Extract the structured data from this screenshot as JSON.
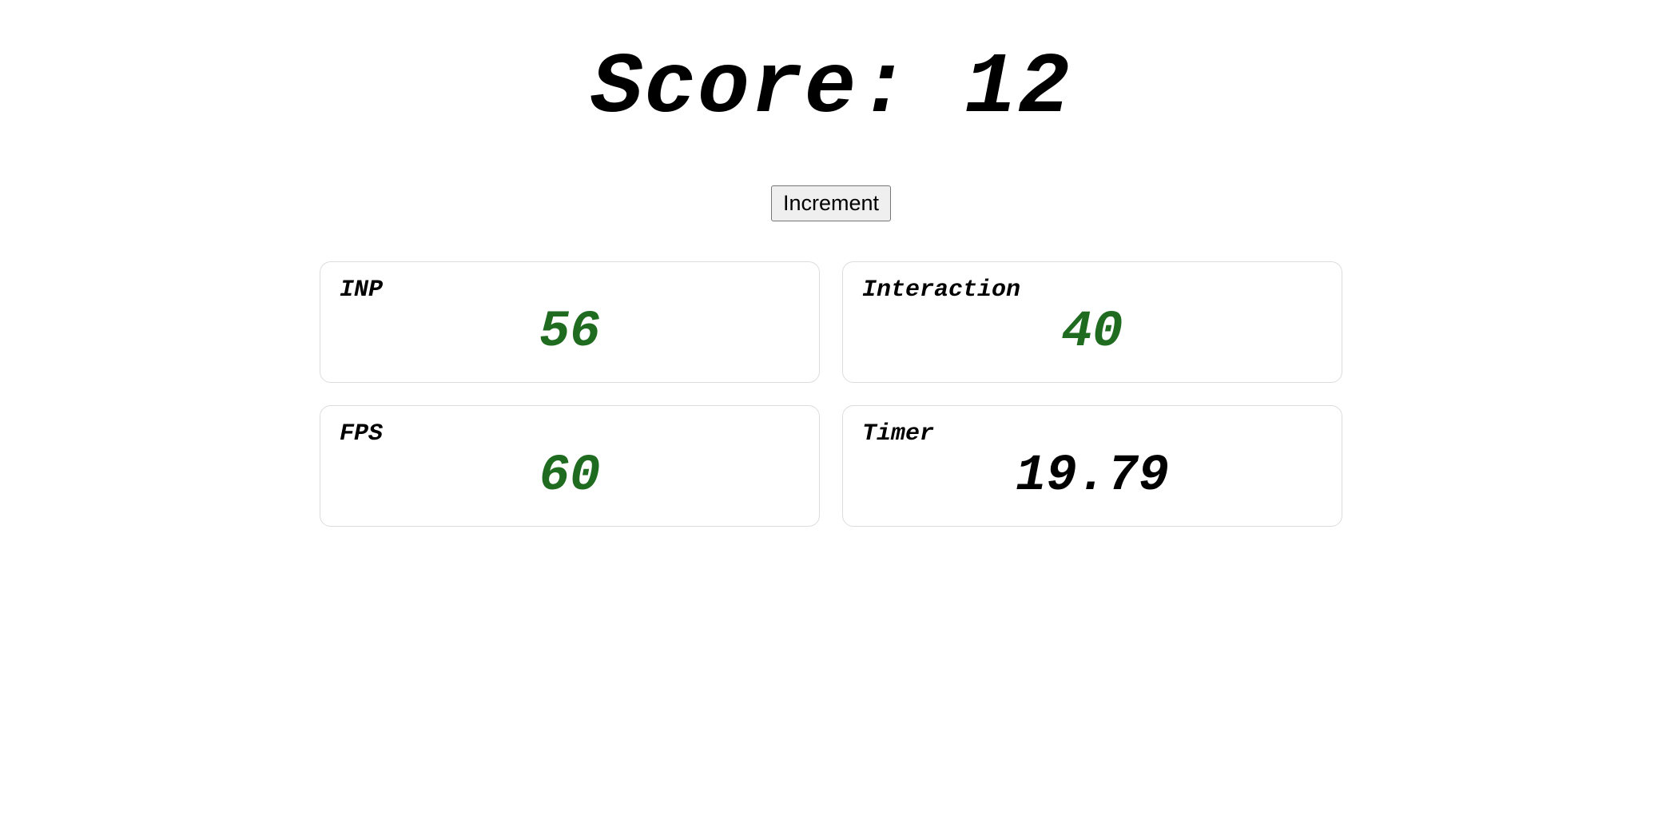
{
  "score": {
    "prefix": "Score: ",
    "value": "12"
  },
  "button": {
    "increment_label": "Increment"
  },
  "cards": {
    "inp": {
      "label": "INP",
      "value": "56"
    },
    "interaction": {
      "label": "Interaction",
      "value": "40"
    },
    "fps": {
      "label": "FPS",
      "value": "60"
    },
    "timer": {
      "label": "Timer",
      "value": "19.79"
    }
  }
}
